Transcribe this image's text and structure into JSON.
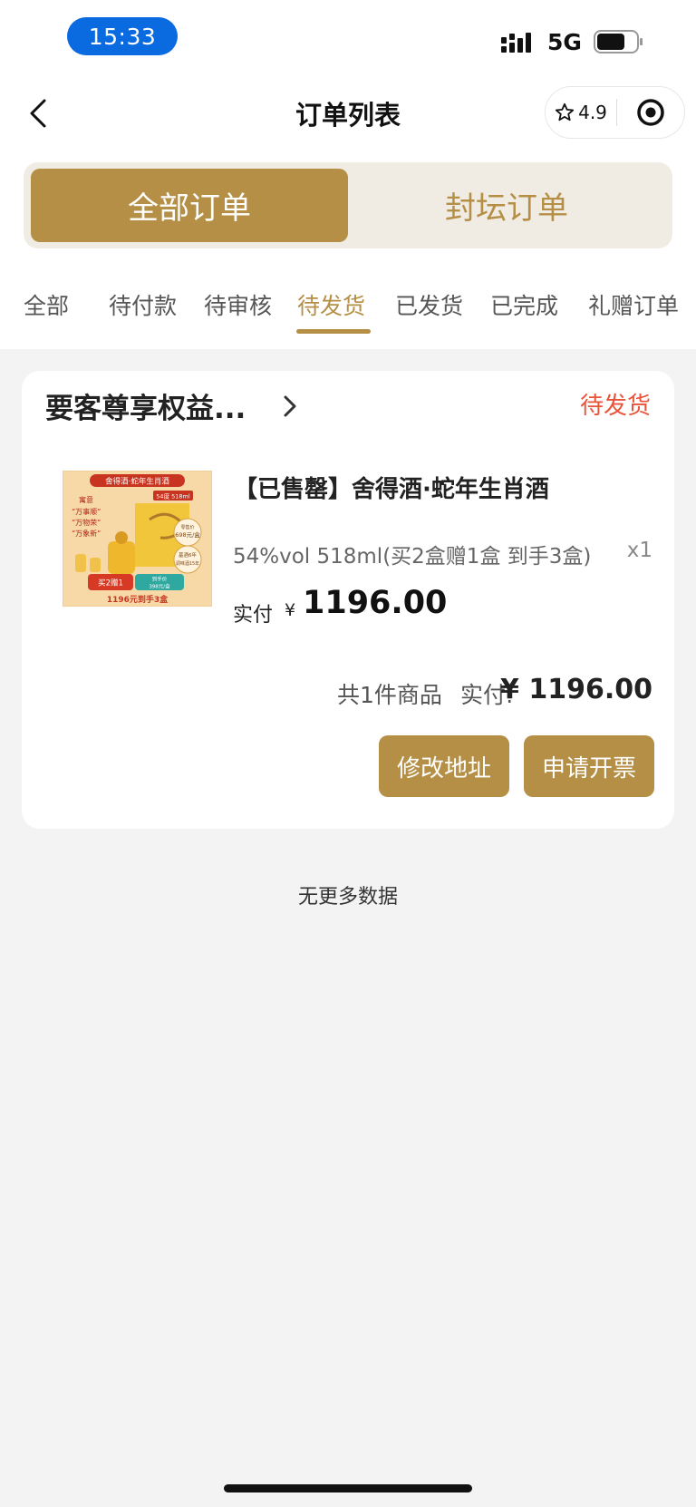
{
  "status_bar": {
    "time": "15:33",
    "network": "5G"
  },
  "nav": {
    "title": "订单列表",
    "rating": "4.9"
  },
  "segments": [
    {
      "label": "全部订单",
      "active": true
    },
    {
      "label": "封坛订单",
      "active": false
    }
  ],
  "tabs": [
    {
      "label": "全部",
      "active": false
    },
    {
      "label": "待付款",
      "active": false
    },
    {
      "label": "待审核",
      "active": false
    },
    {
      "label": "待发货",
      "active": true
    },
    {
      "label": "已发货",
      "active": false
    },
    {
      "label": "已完成",
      "active": false
    },
    {
      "label": "礼赠订单",
      "active": false
    }
  ],
  "order": {
    "shop_name": "要客尊享权益...",
    "status": "待发货",
    "product": {
      "title": "【已售罄】舍得酒·蛇年生肖酒",
      "spec": "54%vol 518ml(买2盒赠1盒 到手3盒)",
      "quantity": "x1",
      "paid_label": "实付",
      "currency": "¥",
      "price": "1196.00",
      "image_text": {
        "banner": "舍得酒·蛇年生肖酒",
        "tag": "54度 518ml",
        "slogan_1": "寓意",
        "slogan_2": "“万事顺”",
        "slogan_3": "“万物荣”",
        "slogan_4": "“万象新”",
        "retail_price": "零售价",
        "retail_value": "698元/盒",
        "age_label_1": "基酒6年",
        "age_label_2": "调味酒15年",
        "promo_left": "买2赠1",
        "promo_right_1": "到手价",
        "promo_right_2": "398元/盒",
        "bottom": "1196元到手3盒"
      }
    },
    "summary": {
      "count_text": "共1件商品",
      "paid_label": "实付:",
      "total": "¥ 1196.00"
    },
    "buttons": {
      "change_address": "修改地址",
      "apply_invoice": "申请开票"
    }
  },
  "footer_text": "无更多数据",
  "colors": {
    "accent": "#b48f45",
    "status_red": "#e8533a",
    "time_pill": "#0a6ae0"
  }
}
